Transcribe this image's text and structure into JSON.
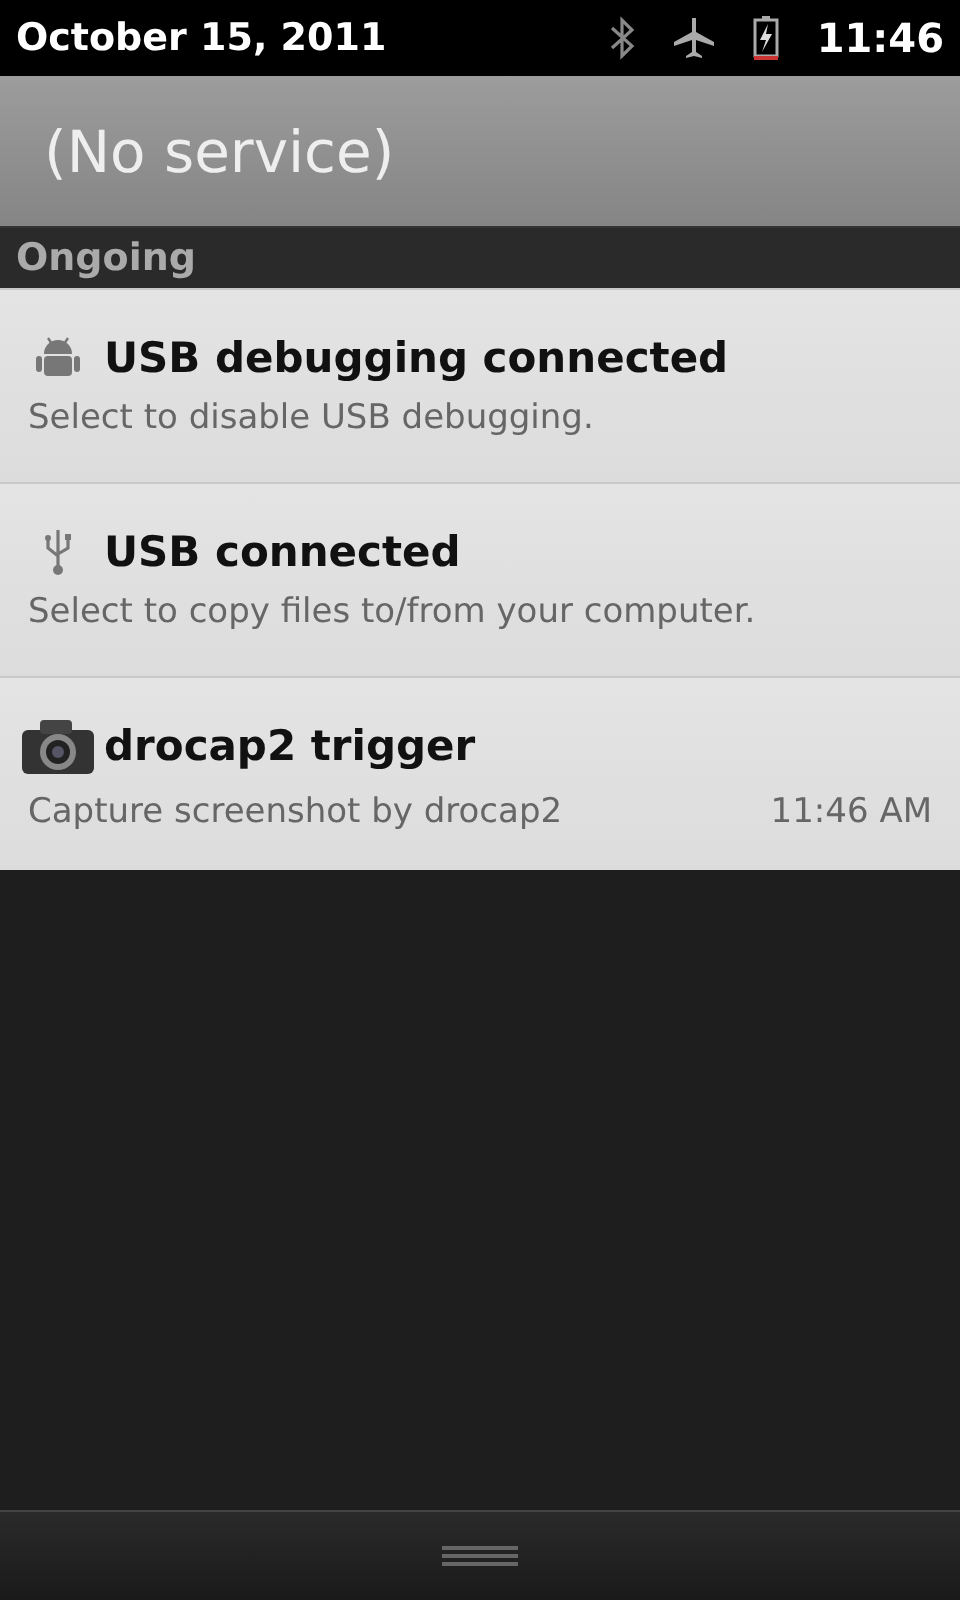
{
  "status_bar": {
    "date": "October 15, 2011",
    "time": "11:46"
  },
  "carrier": "(No service)",
  "section": "Ongoing",
  "notifications": [
    {
      "kind": "android",
      "title": "USB debugging connected",
      "text": "Select to disable USB debugging."
    },
    {
      "kind": "usb",
      "title": "USB connected",
      "text": "Select to copy files to/from your computer."
    },
    {
      "kind": "camera",
      "title": "drocap2 trigger",
      "text": "Capture screenshot by drocap2",
      "time": "11:46 AM"
    }
  ]
}
